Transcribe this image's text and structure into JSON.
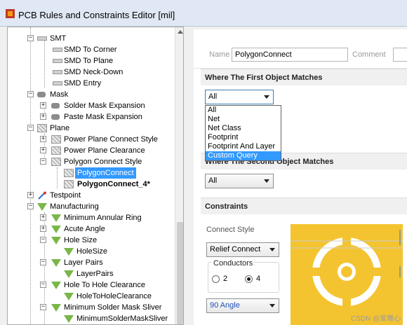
{
  "window": {
    "title": "PCB Rules and Constraints Editor [mil]"
  },
  "tree": {
    "nodes": [
      {
        "label": "SMT"
      },
      {
        "label": "SMD To Corner"
      },
      {
        "label": "SMD To Plane"
      },
      {
        "label": "SMD Neck-Down"
      },
      {
        "label": "SMD Entry"
      },
      {
        "label": "Mask"
      },
      {
        "label": "Solder Mask Expansion"
      },
      {
        "label": "Paste Mask Expansion"
      },
      {
        "label": "Plane"
      },
      {
        "label": "Power Plane Connect Style"
      },
      {
        "label": "Power Plane Clearance"
      },
      {
        "label": "Polygon Connect Style"
      },
      {
        "label": "PolygonConnect"
      },
      {
        "label": "PolygonConnect_4*"
      },
      {
        "label": "Testpoint"
      },
      {
        "label": "Manufacturing"
      },
      {
        "label": "Minimum Annular Ring"
      },
      {
        "label": "Acute Angle"
      },
      {
        "label": "Hole Size"
      },
      {
        "label": "HoleSize"
      },
      {
        "label": "Layer Pairs"
      },
      {
        "label": "LayerPairs"
      },
      {
        "label": "Hole To Hole Clearance"
      },
      {
        "label": "HoleToHoleClearance"
      },
      {
        "label": "Minimum Solder Mask Sliver"
      },
      {
        "label": "MinimumSolderMaskSliver"
      }
    ]
  },
  "rule": {
    "name_label": "Name",
    "name_value": "PolygonConnect",
    "comment_label": "Comment"
  },
  "first_match": {
    "heading": "Where The First Object Matches",
    "selected": "All",
    "options": [
      "All",
      "Net",
      "Net Class",
      "Footprint",
      "Footprint And Layer",
      "Custom Query"
    ],
    "highlighted": "Custom Query"
  },
  "second_match": {
    "heading": "Where The Second Object Matches",
    "selected": "All"
  },
  "constraints": {
    "heading": "Constraints",
    "connect_style_label": "Connect Style",
    "connect_style_value": "Relief Connect",
    "conductors_label": "Conductors",
    "conductor_options": [
      "2",
      "4"
    ],
    "conductor_selected": "4",
    "angle_value": "90 Angle"
  },
  "watermark": "CSDN @爱撒心",
  "colors": {
    "selection": "#3399ff",
    "preview_copper": "#f4c430",
    "preview_anti": "#ffffff"
  }
}
